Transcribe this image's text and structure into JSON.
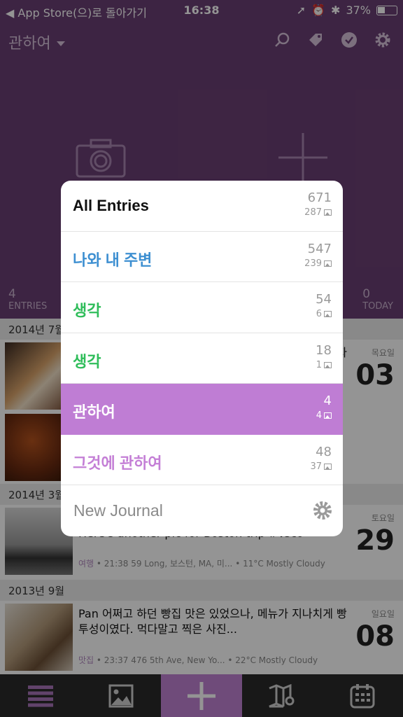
{
  "status_bar": {
    "back_label": "◀ App Store(으)로 돌아가기",
    "time": "16:38",
    "battery": "37%"
  },
  "header": {
    "journal_name": "관하여",
    "icons": [
      "search-icon",
      "tag-icon",
      "checkmark-icon",
      "gear-icon"
    ],
    "stats": {
      "entries_count": "4",
      "entries_label": "ENTRIES",
      "today_count": "0",
      "today_label": "TODAY"
    }
  },
  "timeline": {
    "sections": [
      "2014년 7월",
      "2014년 3월",
      "2013년 9월"
    ],
    "entries": [
      {
        "text": "자",
        "dow": "목요일",
        "day": "03",
        "meta_tag": "",
        "meta": ""
      },
      {
        "text": "",
        "dow": "",
        "day": "",
        "meta_tag": "",
        "meta": ""
      },
      {
        "text": "Here's another pic for Boston trip #vsco",
        "dow": "토요일",
        "day": "29",
        "meta_tag": "여행",
        "meta": " • 21:38 59 Long, 보스턴, MA, 미... • 11°C Mostly Cloudy"
      },
      {
        "text": "Pan 어쩌고 하던 빵집 맛은 있었으나, 메뉴가 지나치게 빵투성이였다. 먹다말고 찍은 사진...",
        "dow": "일요일",
        "day": "08",
        "meta_tag": "맛집",
        "meta": " • 23:37 476 5th Ave, New Yo... • 22°C Mostly Cloudy"
      }
    ]
  },
  "journal_menu": {
    "journals": [
      {
        "name": "All Entries",
        "count": "671",
        "photos": "287",
        "color": "#111111"
      },
      {
        "name": "나와 내 주변",
        "count": "547",
        "photos": "239",
        "color": "#3d8fd1"
      },
      {
        "name": "생각",
        "count": "54",
        "photos": "6",
        "color": "#2fbd5a"
      },
      {
        "name": "생각",
        "count": "18",
        "photos": "1",
        "color": "#2fbd5a"
      },
      {
        "name": "관하여",
        "count": "4",
        "photos": "4",
        "color": "#ffffff",
        "selected": true
      },
      {
        "name": "그것에 관하여",
        "count": "48",
        "photos": "37",
        "color": "#c47fd6"
      }
    ],
    "new_journal_label": "New Journal"
  },
  "tab_bar": {
    "tabs": [
      "list-icon",
      "photos-icon",
      "add-icon",
      "map-icon",
      "calendar-icon"
    ],
    "accent": "#c082d2"
  }
}
